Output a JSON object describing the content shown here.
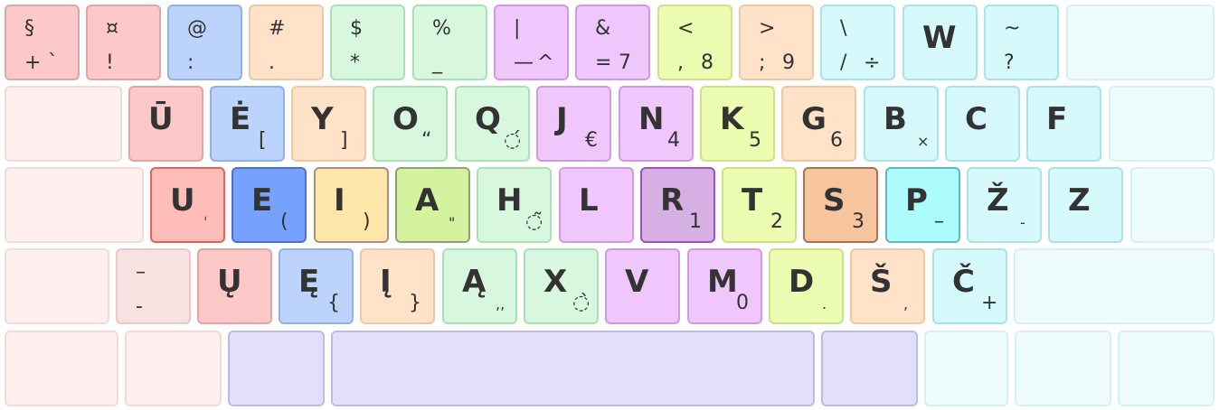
{
  "keys": [
    {
      "id": "sect",
      "tl": "§",
      "bl": "+",
      "bm": "`",
      "color": "red"
    },
    {
      "id": "curr",
      "tl": "¤",
      "bl": "!",
      "color": "red"
    },
    {
      "id": "at",
      "tl": "@",
      "bl": ":",
      "color": "blue"
    },
    {
      "id": "hash",
      "tl": "#",
      "bl": ".",
      "color": "orange"
    },
    {
      "id": "dollar",
      "tl": "$",
      "bl": "*",
      "color": "green"
    },
    {
      "id": "percent",
      "tl": "%",
      "bl": "_",
      "color": "green"
    },
    {
      "id": "pipe",
      "tl": "|",
      "bl": "—",
      "bm": "^",
      "color": "purple"
    },
    {
      "id": "amp",
      "tl": "&",
      "bl": "=",
      "bm": "7",
      "color": "purple"
    },
    {
      "id": "lt",
      "tl": "<",
      "bl": ",",
      "bm": "8",
      "color": "yellow"
    },
    {
      "id": "gt",
      "tl": ">",
      "bl": ";",
      "bm": "9",
      "color": "peach"
    },
    {
      "id": "bslash",
      "tl": "\\",
      "bl": "/",
      "bm": "÷",
      "color": "cyan"
    },
    {
      "id": "w",
      "main": "W",
      "color": "cyan"
    },
    {
      "id": "tilde",
      "tl": "~",
      "bl": "?",
      "color": "cyan"
    },
    {
      "id": "backspace",
      "color": "cyan-faded"
    },
    {
      "id": "tab",
      "color": "red-faded"
    },
    {
      "id": "u-macron",
      "main": "Ū",
      "color": "red"
    },
    {
      "id": "e-dot",
      "main": "Ė",
      "br": "[",
      "color": "blue"
    },
    {
      "id": "y",
      "main": "Y",
      "br": "]",
      "color": "orange"
    },
    {
      "id": "o",
      "main": "O",
      "br": "“",
      "color": "green"
    },
    {
      "id": "q",
      "main": "Q",
      "br": "◌́",
      "color": "green"
    },
    {
      "id": "j",
      "main": "J",
      "br": "€",
      "color": "purple"
    },
    {
      "id": "n",
      "main": "N",
      "br": "4",
      "color": "purple"
    },
    {
      "id": "k",
      "main": "K",
      "br": "5",
      "color": "yellow"
    },
    {
      "id": "g",
      "main": "G",
      "br": "6",
      "color": "peach"
    },
    {
      "id": "b",
      "main": "B",
      "brs": "×",
      "color": "cyan"
    },
    {
      "id": "c",
      "main": "C",
      "color": "cyan"
    },
    {
      "id": "f",
      "main": "F",
      "color": "cyan"
    },
    {
      "id": "backslash-key",
      "color": "cyan-faded"
    },
    {
      "id": "caps",
      "color": "red-faded"
    },
    {
      "id": "u",
      "main": "U",
      "brs": "ˈ",
      "color": "red-home"
    },
    {
      "id": "e",
      "main": "E",
      "br": "(",
      "color": "blue-home"
    },
    {
      "id": "i",
      "main": "I",
      "br": ")",
      "color": "orange-home"
    },
    {
      "id": "a",
      "main": "A",
      "brs": "\"",
      "color": "green-home"
    },
    {
      "id": "h",
      "main": "H",
      "br": "◌̃",
      "color": "green"
    },
    {
      "id": "l",
      "main": "L",
      "color": "purple"
    },
    {
      "id": "r",
      "main": "R",
      "br": "1",
      "color": "purple-home"
    },
    {
      "id": "t",
      "main": "T",
      "br": "2",
      "color": "yellow"
    },
    {
      "id": "s",
      "main": "S",
      "br": "3",
      "color": "peach-home"
    },
    {
      "id": "p",
      "main": "P",
      "br": "–",
      "color": "cyan-home"
    },
    {
      "id": "z-caron",
      "main": "Ž",
      "brs": "-",
      "color": "cyan"
    },
    {
      "id": "z",
      "main": "Z",
      "color": "cyan"
    },
    {
      "id": "enter",
      "color": "cyan-faded"
    },
    {
      "id": "lshift",
      "color": "red-faded"
    },
    {
      "id": "dash",
      "tl": "–",
      "bl": "-",
      "color": "red-pale"
    },
    {
      "id": "u-ogonek",
      "main": "Ų",
      "color": "red"
    },
    {
      "id": "e-ogonek",
      "main": "Ę",
      "br": "{",
      "color": "blue"
    },
    {
      "id": "i-ogonek",
      "main": "Į",
      "br": "}",
      "color": "orange"
    },
    {
      "id": "a-ogonek",
      "main": "Ą",
      "brs": ",,",
      "color": "green"
    },
    {
      "id": "x",
      "main": "X",
      "br": "◌̀",
      "color": "green"
    },
    {
      "id": "v",
      "main": "V",
      "color": "purple"
    },
    {
      "id": "m",
      "main": "M",
      "br": "0",
      "color": "purple"
    },
    {
      "id": "d",
      "main": "D",
      "brs": ".",
      "color": "yellow"
    },
    {
      "id": "s-caron",
      "main": "Š",
      "brs": ",",
      "color": "peach"
    },
    {
      "id": "c-caron",
      "main": "Č",
      "br": "+",
      "color": "cyan"
    },
    {
      "id": "rshift",
      "color": "cyan-faded"
    },
    {
      "id": "lctrl",
      "color": "red-faded"
    },
    {
      "id": "lmeta",
      "color": "red-faded"
    },
    {
      "id": "lalt",
      "color": "lavender"
    },
    {
      "id": "space",
      "color": "lavender"
    },
    {
      "id": "ralt",
      "color": "lavender"
    },
    {
      "id": "rmeta",
      "color": "cyan-faded"
    },
    {
      "id": "menu",
      "color": "cyan-faded"
    },
    {
      "id": "rctrl",
      "color": "cyan-faded"
    }
  ],
  "colors": {
    "red": {
      "bg": "#fdc8c8",
      "border": "#e0a5a5"
    },
    "red-faded": {
      "bg": "#fff0ef",
      "border": "#f5d9d8"
    },
    "red-pale": {
      "bg": "#f8e2e1",
      "border": "#e8c9c8"
    },
    "red-home": {
      "bg": "#ffbdb9",
      "border": "#e4605a"
    },
    "blue": {
      "bg": "#bcd4fc",
      "border": "#93b0e8"
    },
    "blue-home": {
      "bg": "#76a1fc",
      "border": "#4f6fcf"
    },
    "orange": {
      "bg": "#ffe2c7",
      "border": "#ecc9a6"
    },
    "orange-home": {
      "bg": "#ffe6a9",
      "border": "#b38b7c"
    },
    "green": {
      "bg": "#d8f7df",
      "border": "#a9e2b2"
    },
    "green-home": {
      "bg": "#d5f29e",
      "border": "#8ea27a"
    },
    "purple": {
      "bg": "#f0c7fd",
      "border": "#d09ae2"
    },
    "purple-home": {
      "bg": "#d6b0e4",
      "border": "#a04fbf"
    },
    "yellow": {
      "bg": "#ecfdb1",
      "border": "#cfe089"
    },
    "peach": {
      "bg": "#ffe2c7",
      "border": "#ecc9a6"
    },
    "peach-home": {
      "bg": "#f6c59e",
      "border": "#a67259"
    },
    "cyan": {
      "bg": "#d6f9fb",
      "border": "#a8e3e6"
    },
    "cyan-home": {
      "bg": "#acfcfd",
      "border": "#63b8bd"
    },
    "cyan-faded": {
      "bg": "#effcfc",
      "border": "#d7f1f1"
    },
    "lavender": {
      "bg": "#e2dffd",
      "border": "#bebbe0"
    }
  }
}
